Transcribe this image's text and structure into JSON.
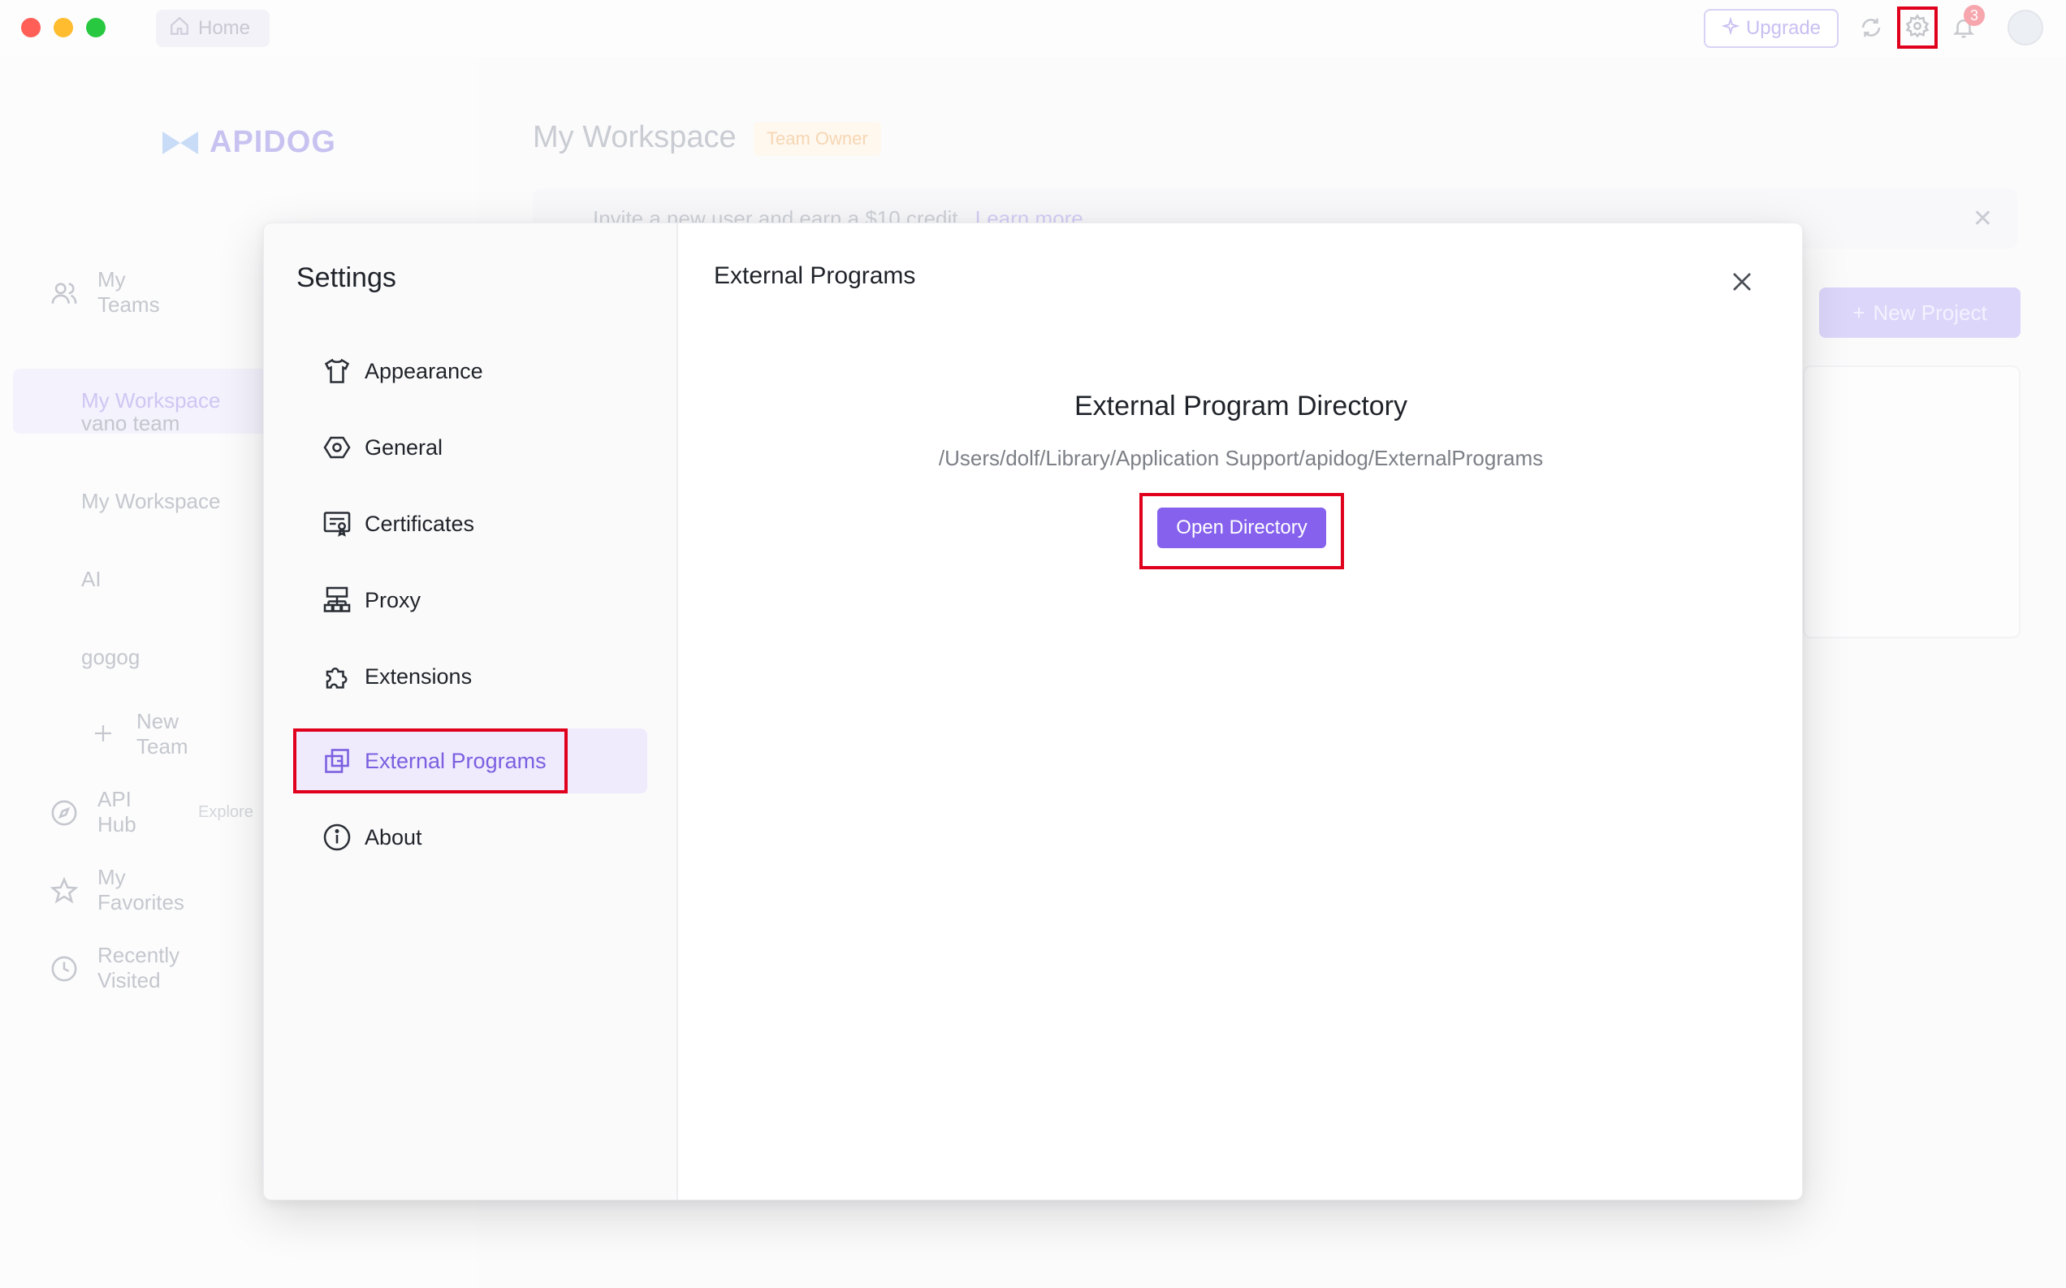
{
  "titlebar": {
    "home_tab": "Home",
    "upgrade_label": "Upgrade",
    "notification_count": "3"
  },
  "sidebar": {
    "logo_text": "APIDOG",
    "my_teams": "My Teams",
    "teams": [
      "My Workspace",
      "vano team",
      "My Workspace",
      "AI",
      "gogog"
    ],
    "new_team": "New Team",
    "api_hub": "API Hub",
    "api_hub_tag": "Explore",
    "my_favorites": "My Favorites",
    "recently_visited": "Recently Visited"
  },
  "main": {
    "workspace_title": "My Workspace",
    "role_badge": "Team Owner",
    "invite_text": "Invite a new user and earn a $10 credit",
    "invite_link": "Learn more",
    "new_project": "New Project"
  },
  "settings": {
    "title": "Settings",
    "nav": [
      {
        "label": "Appearance",
        "icon": "shirt-icon"
      },
      {
        "label": "General",
        "icon": "hexagon-settings-icon"
      },
      {
        "label": "Certificates",
        "icon": "certificate-icon"
      },
      {
        "label": "Proxy",
        "icon": "network-icon"
      },
      {
        "label": "Extensions",
        "icon": "puzzle-icon"
      },
      {
        "label": "External Programs",
        "icon": "external-programs-icon"
      },
      {
        "label": "About",
        "icon": "info-icon"
      }
    ],
    "active_index": 5,
    "content_title": "External Programs",
    "directory_title": "External Program Directory",
    "directory_path": "/Users/dolf/Library/Application Support/apidog/ExternalPrograms",
    "open_button": "Open Directory"
  },
  "colors": {
    "accent": "#8561ed",
    "highlight_outline": "#e0001b"
  }
}
